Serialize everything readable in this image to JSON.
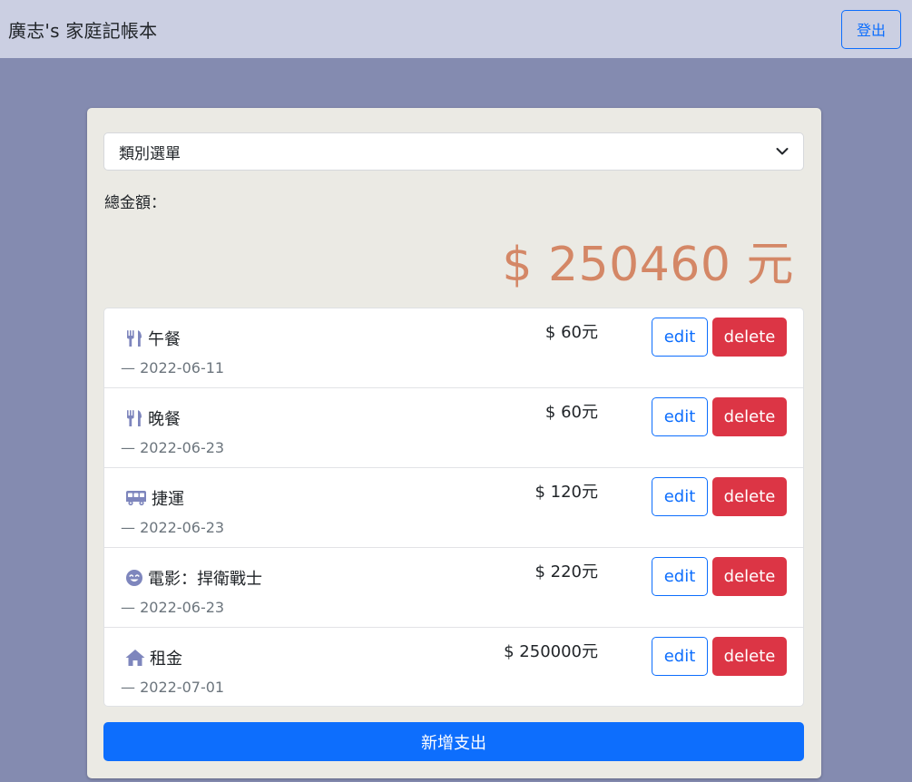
{
  "header": {
    "title": "廣志's 家庭記帳本",
    "logout_label": "登出"
  },
  "filter": {
    "selected": "類別選單"
  },
  "summary": {
    "label": "總金額：",
    "amount": "$ 250460 元"
  },
  "items": [
    {
      "icon": "utensils-icon",
      "name": "午餐",
      "date": "— 2022-06-11",
      "price": "$ 60元",
      "edit_label": "edit",
      "delete_label": "delete"
    },
    {
      "icon": "utensils-icon",
      "name": "晚餐",
      "date": "— 2022-06-23",
      "price": "$ 60元",
      "edit_label": "edit",
      "delete_label": "delete"
    },
    {
      "icon": "bus-icon",
      "name": "捷運",
      "date": "— 2022-06-23",
      "price": "$ 120元",
      "edit_label": "edit",
      "delete_label": "delete"
    },
    {
      "icon": "smile-icon",
      "name": "電影：捍衛戰士",
      "date": "— 2022-06-23",
      "price": "$ 220元",
      "edit_label": "edit",
      "delete_label": "delete"
    },
    {
      "icon": "home-icon",
      "name": "租金",
      "date": "— 2022-07-01",
      "price": "$ 250000元",
      "edit_label": "edit",
      "delete_label": "delete"
    }
  ],
  "add_button": "新增支出",
  "colors": {
    "page_background": "#848bb0",
    "navbar": "#cbcfe2",
    "card": "#ebeae4",
    "total_amount": "#d48766",
    "icon": "#7e86bd",
    "primary": "#0d6efd",
    "danger": "#dc3545"
  }
}
